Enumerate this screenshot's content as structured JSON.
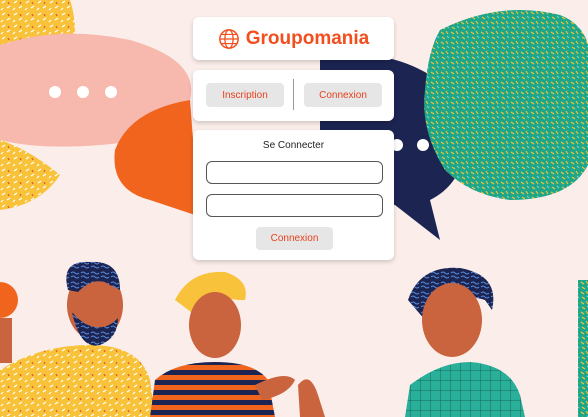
{
  "brand": {
    "name": "Groupomania",
    "icon": "globe-icon",
    "color": "#f24e1e"
  },
  "nav": {
    "signup_label": "Inscription",
    "login_label": "Connexion"
  },
  "login": {
    "title": "Se Connecter",
    "email_value": "",
    "password_value": "",
    "submit_label": "Connexion"
  },
  "colors": {
    "accent": "#e8401c",
    "button_bg": "#e6e6e6",
    "background": "#fbeeea"
  }
}
